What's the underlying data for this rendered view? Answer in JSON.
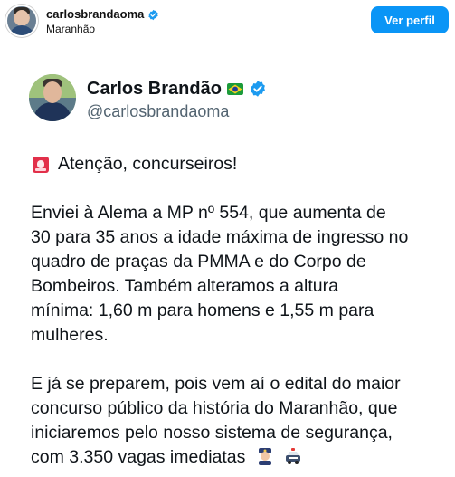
{
  "instagram_header": {
    "username": "carlosbrandaoma",
    "location": "Maranhão",
    "view_profile_button": "Ver perfil",
    "accent_color": "#0a95f6"
  },
  "tweet": {
    "display_name": "Carlos Brandão",
    "handle": "@carlosbrandaoma",
    "icons": [
      "brazil-flag-icon",
      "verified-icon"
    ],
    "alert_line": "Atenção, concurseiros!",
    "paragraph_1": [
      "Enviei à Alema a MP nº 554, que aumenta de",
      "30 para 35 anos a idade máxima de ingresso no",
      "quadro de praças da PMMA e do Corpo de",
      "Bombeiros. Também alteramos a altura",
      "mínima: 1,60 m para homens e 1,55 m para",
      "mulheres."
    ],
    "paragraph_2": [
      "E já se preparem, pois vem aí o edital do maior",
      "concurso público da história do Maranhão, que",
      "iniciaremos pelo nosso sistema de segurança,",
      "com 3.350 vagas imediatas"
    ],
    "trailing_emoji_icons": [
      "police-officer-icon",
      "police-car-icon"
    ]
  }
}
